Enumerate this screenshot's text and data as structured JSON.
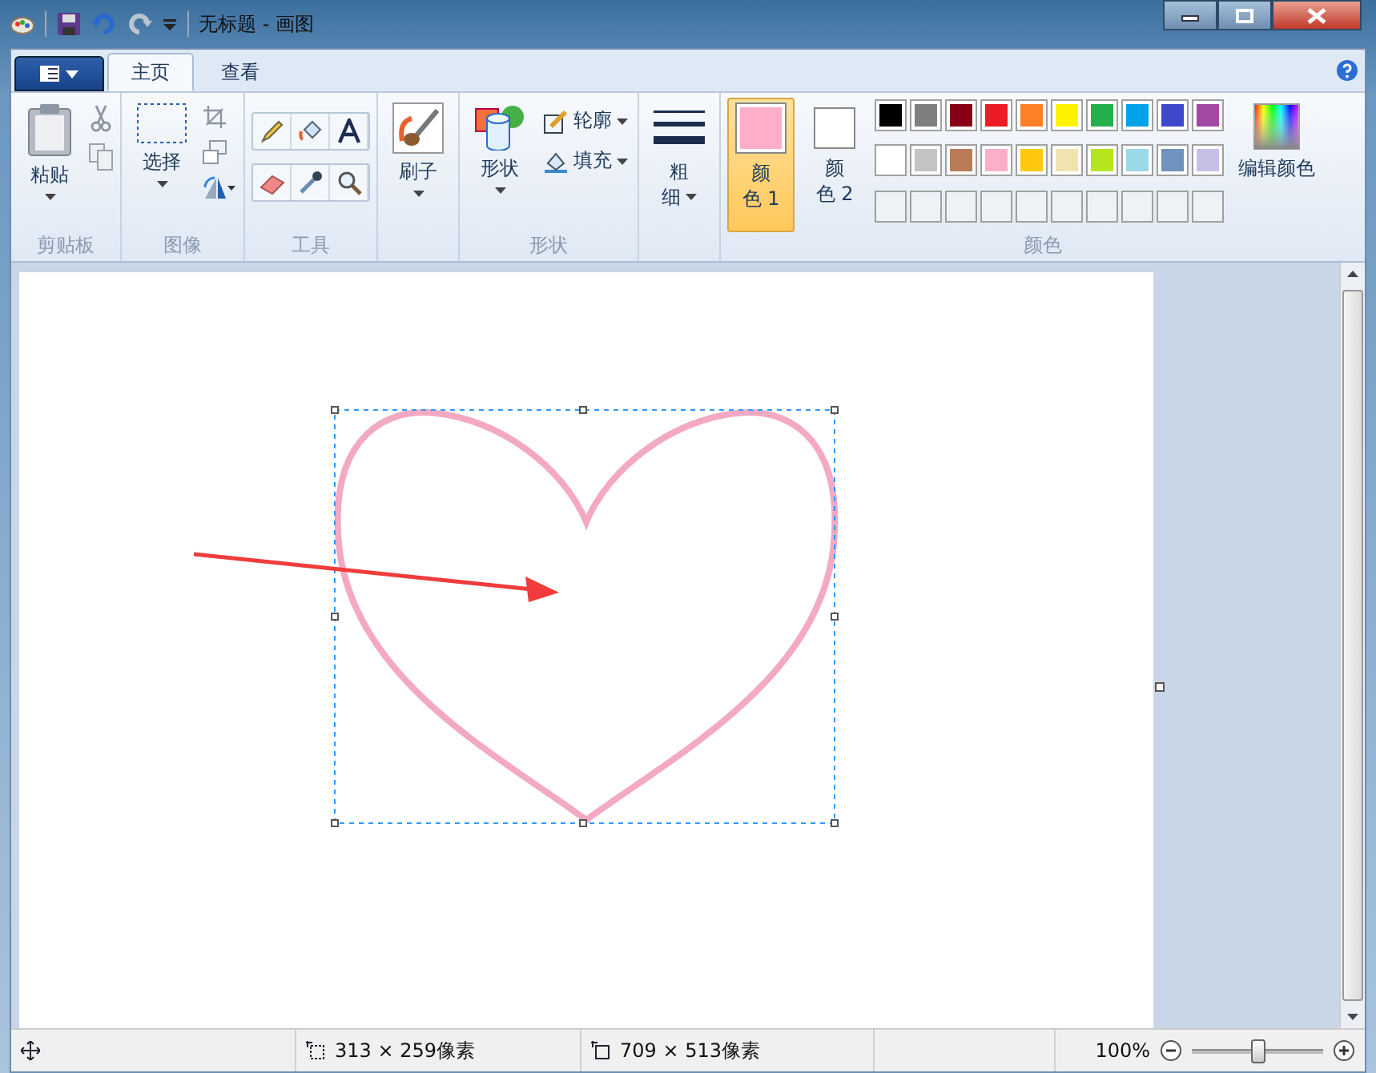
{
  "window": {
    "title": "无标题 - 画图"
  },
  "tabs": [
    {
      "label": "主页",
      "selected": true
    },
    {
      "label": "查看",
      "selected": false
    }
  ],
  "ribbon": {
    "clipboard": {
      "label": "剪贴板",
      "paste": "粘贴"
    },
    "image": {
      "label": "图像",
      "select": "选择"
    },
    "tools": {
      "label": "工具"
    },
    "brushes": {
      "button": "刷子"
    },
    "shapes": {
      "label": "形状",
      "button": "形状",
      "outline": "轮廓",
      "fill": "填充"
    },
    "size": {
      "button_lines": [
        "粗",
        "细"
      ]
    },
    "colors": {
      "label": "颜色",
      "edit": "编辑颜色",
      "slots": [
        {
          "label_lines": [
            "颜",
            "色 1"
          ],
          "color": "#ffaec9",
          "selected": true
        },
        {
          "label_lines": [
            "颜",
            "色 2"
          ],
          "color": "#ffffff",
          "selected": false
        }
      ],
      "palette": [
        {
          "kind": "color",
          "color": "#000000"
        },
        {
          "kind": "color",
          "color": "#7f7f7f"
        },
        {
          "kind": "color",
          "color": "#880015"
        },
        {
          "kind": "color",
          "color": "#ed1c24"
        },
        {
          "kind": "color",
          "color": "#ff7f27"
        },
        {
          "kind": "color",
          "color": "#fff200"
        },
        {
          "kind": "color",
          "color": "#22b14c"
        },
        {
          "kind": "color",
          "color": "#00a2e8"
        },
        {
          "kind": "color",
          "color": "#3f48cc"
        },
        {
          "kind": "color",
          "color": "#a349a4"
        },
        {
          "kind": "color",
          "color": "#ffffff"
        },
        {
          "kind": "color",
          "color": "#c3c3c3"
        },
        {
          "kind": "color",
          "color": "#b97a57"
        },
        {
          "kind": "color",
          "color": "#ffaec9"
        },
        {
          "kind": "color",
          "color": "#ffc90e"
        },
        {
          "kind": "color",
          "color": "#efe4b0"
        },
        {
          "kind": "color",
          "color": "#b5e61d"
        },
        {
          "kind": "color",
          "color": "#99d9ea"
        },
        {
          "kind": "color",
          "color": "#7092be"
        },
        {
          "kind": "color",
          "color": "#c8bfe7"
        },
        {
          "kind": "empty"
        },
        {
          "kind": "empty"
        },
        {
          "kind": "empty"
        },
        {
          "kind": "empty"
        },
        {
          "kind": "empty"
        },
        {
          "kind": "empty"
        },
        {
          "kind": "empty"
        },
        {
          "kind": "empty"
        },
        {
          "kind": "empty"
        },
        {
          "kind": "empty"
        }
      ]
    }
  },
  "status_bar": {
    "selection_size": "313 × 259像素",
    "canvas_size": "709 × 513像素",
    "zoom": "100%",
    "zoom_slider": {
      "level": 0.5
    }
  }
}
